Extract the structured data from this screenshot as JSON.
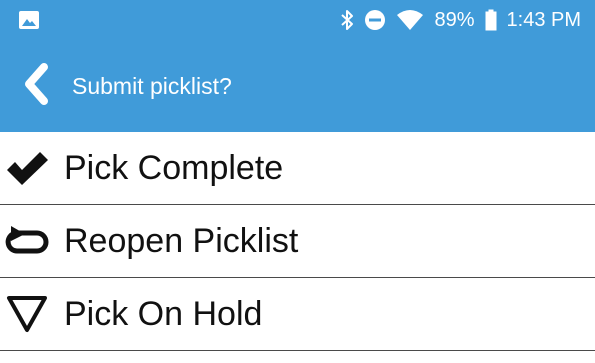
{
  "status_bar": {
    "battery_percent": "89%",
    "time": "1:43 PM",
    "icons": [
      "image-icon",
      "bluetooth-icon",
      "do-not-disturb-icon",
      "wifi-icon",
      "battery-icon"
    ]
  },
  "app_bar": {
    "title": "Submit picklist?",
    "back_icon": "chevron-left-icon"
  },
  "actions": [
    {
      "label": "Pick Complete",
      "icon": "checkmark-icon"
    },
    {
      "label": "Reopen Picklist",
      "icon": "loop-icon"
    },
    {
      "label": "Pick On Hold",
      "icon": "triangle-down-icon"
    }
  ],
  "colors": {
    "primary": "#409bd9",
    "text": "#111111",
    "divider": "#4a4a4a",
    "background": "#ffffff"
  }
}
